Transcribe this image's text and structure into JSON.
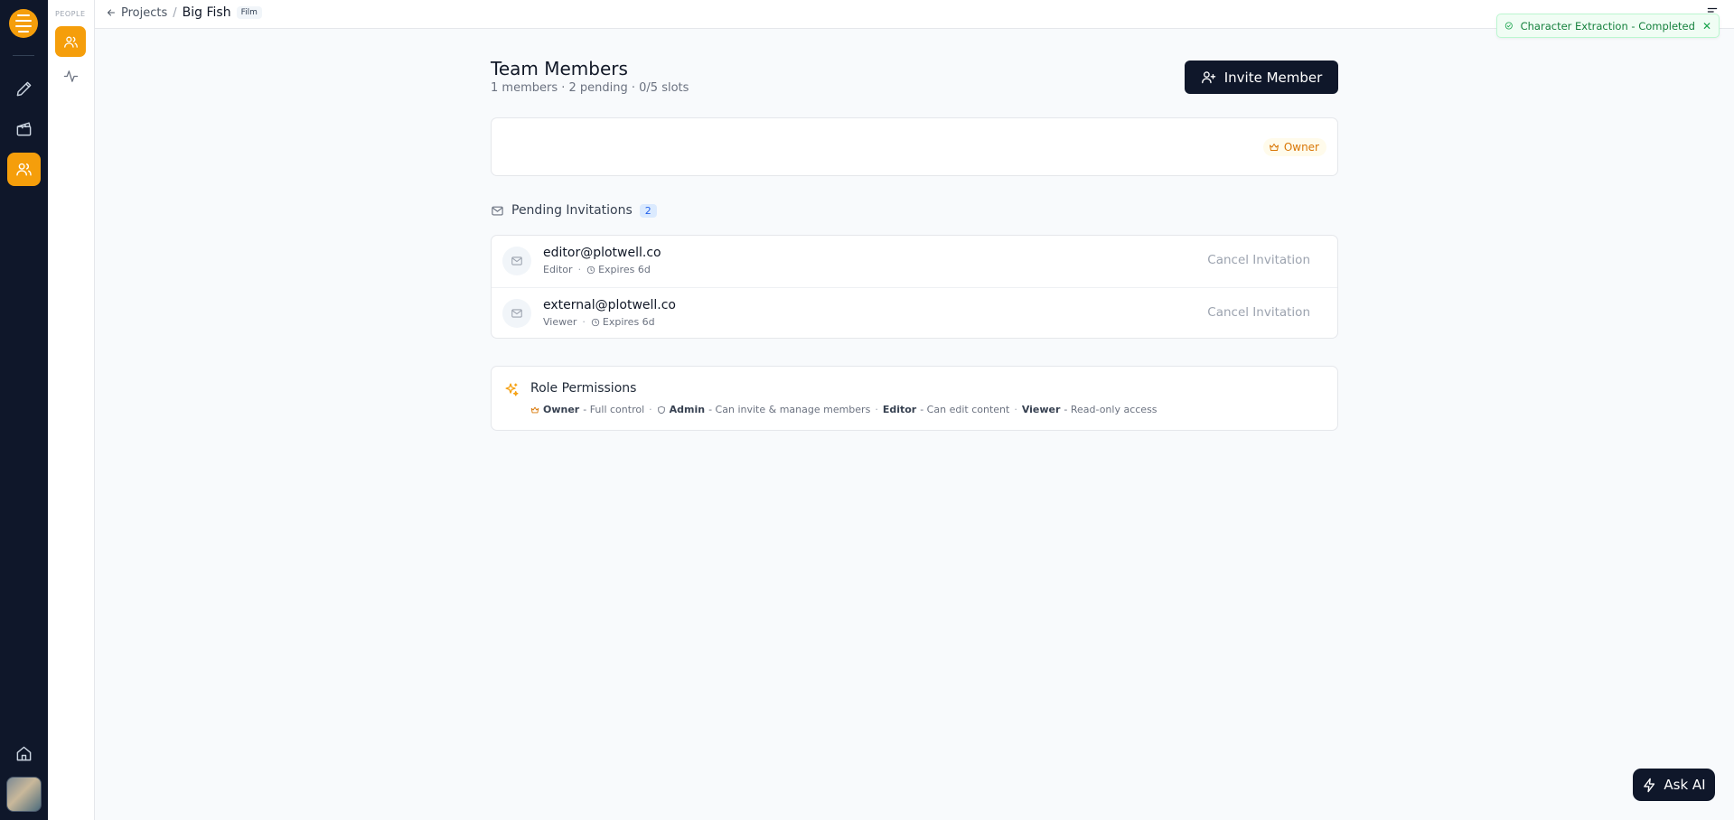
{
  "sidebar": {
    "section_label": "PEOPLE"
  },
  "breadcrumb": {
    "back_label": "Projects",
    "separator": "/",
    "project_name": "Big Fish",
    "project_type": "Film"
  },
  "toast": {
    "message": "Character Extraction - Completed",
    "close": "✕"
  },
  "page": {
    "title": "Team Members",
    "subtitle": "1 members · 2 pending · 0/5 slots",
    "invite_button": "Invite Member"
  },
  "owner_card": {
    "role_badge": "Owner"
  },
  "pending": {
    "title": "Pending Invitations",
    "count": "2",
    "invitations": [
      {
        "email": "editor@plotwell.co",
        "role": "Editor",
        "expires": "Expires 6d",
        "action": "Cancel Invitation"
      },
      {
        "email": "external@plotwell.co",
        "role": "Viewer",
        "expires": "Expires 6d",
        "action": "Cancel Invitation"
      }
    ]
  },
  "permissions": {
    "title": "Role Permissions",
    "roles": [
      {
        "name": "Owner",
        "desc": "- Full control"
      },
      {
        "name": "Admin",
        "desc": "- Can invite & manage members"
      },
      {
        "name": "Editor",
        "desc": "- Can edit content"
      },
      {
        "name": "Viewer",
        "desc": "- Read-only access"
      }
    ],
    "separator": "·"
  },
  "ask_ai": {
    "label": "Ask AI"
  },
  "colors": {
    "accent": "#f59e0b",
    "dark": "#0f172a",
    "success": "#15803d"
  }
}
